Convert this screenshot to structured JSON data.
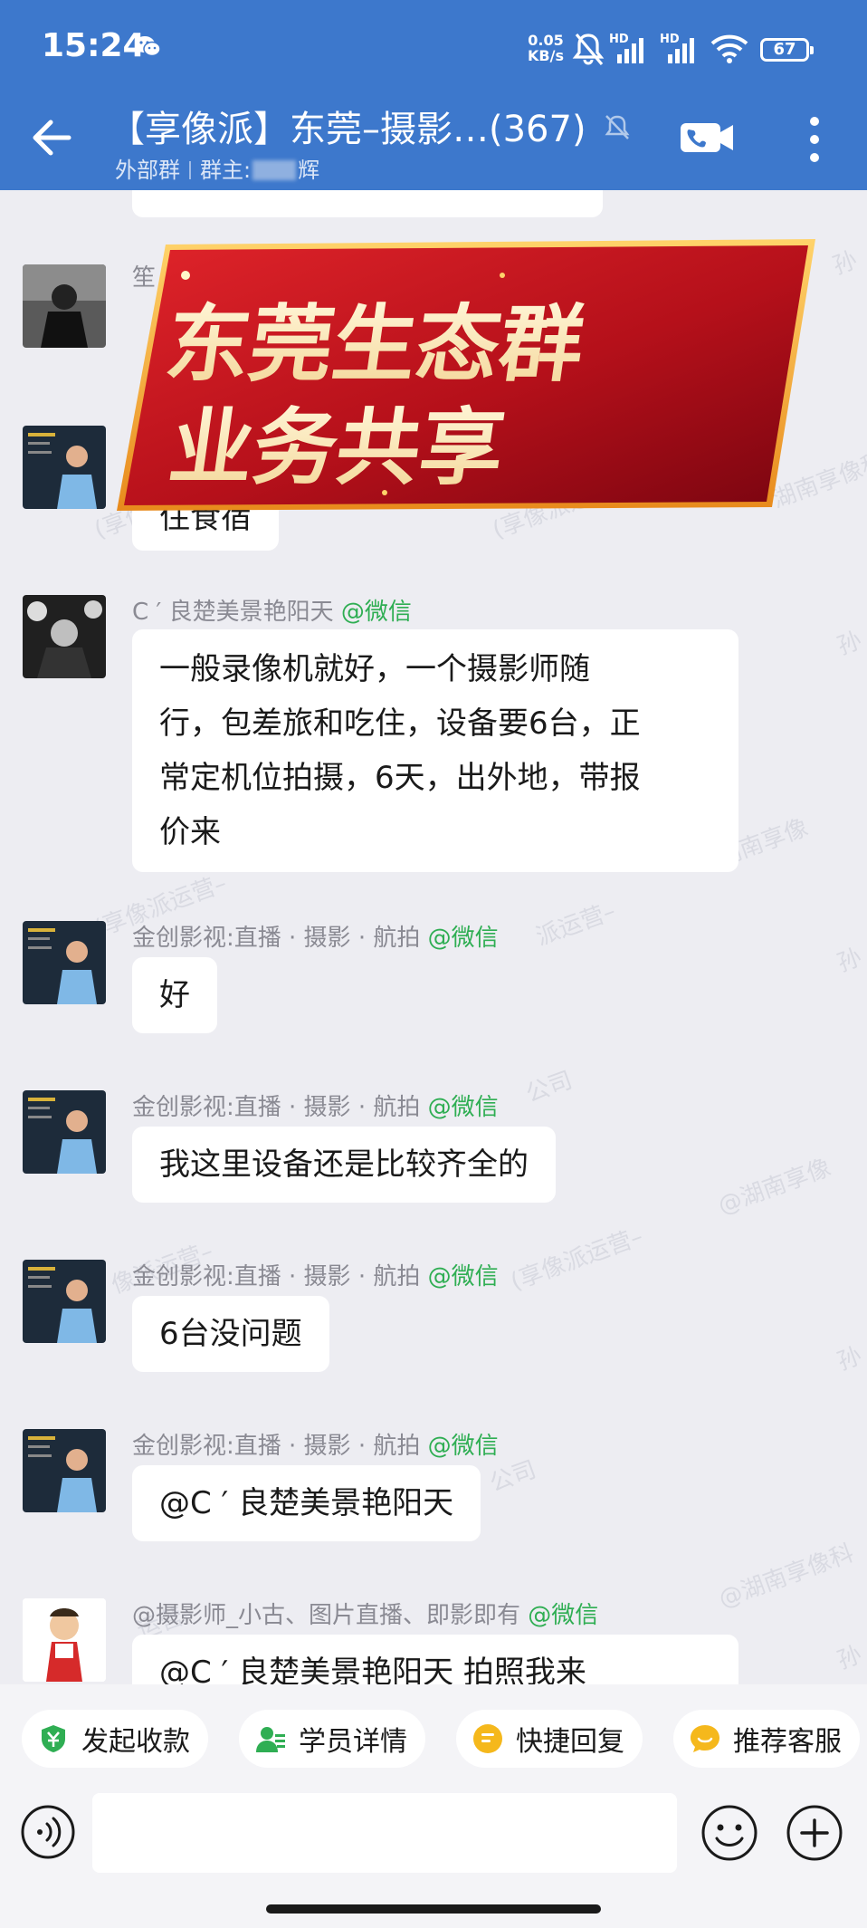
{
  "status_bar": {
    "time": "15:24",
    "net_speed_value": "0.05",
    "net_speed_unit": "KB/s",
    "signal_1_label": "HD",
    "signal_2_label": "HD",
    "battery": "67"
  },
  "header": {
    "title": "【享像派】东莞–摄影…(367)",
    "group_type": "外部群",
    "owner_label": "群主:",
    "owner_name_suffix": "辉"
  },
  "banner": {
    "line1": "东莞生态群",
    "line2": "业务共享"
  },
  "messages": [
    {
      "sender": "笙",
      "text": ""
    },
    {
      "sender": "",
      "text": "住食宿"
    },
    {
      "sender": "C ′  良楚美景艳阳天",
      "sender_tag": "@微信",
      "text_lines": [
        "一般录像机就好，一个摄影师随",
        "行，包差旅和吃住，设备要6台，正",
        "常定机位拍摄，6天，出外地，带报",
        "价来"
      ]
    },
    {
      "sender": "金创影视:直播 · 摄影 · 航拍",
      "sender_tag": "@微信",
      "text": "好"
    },
    {
      "sender": "金创影视:直播 · 摄影 · 航拍",
      "sender_tag": "@微信",
      "text": "我这里设备还是比较齐全的"
    },
    {
      "sender": "金创影视:直播 · 摄影 · 航拍",
      "sender_tag": "@微信",
      "text": "6台没问题"
    },
    {
      "sender": "金创影视:直播 · 摄影 · 航拍",
      "sender_tag": "@微信",
      "text": "@C ′  良楚美景艳阳天"
    },
    {
      "sender": "@摄影师_小古、图片直播、即影即有",
      "sender_tag": "@微信",
      "text": "@C ′  良楚美景艳阳天 拍照我来"
    }
  ],
  "watermarks": [
    "孙",
    "(享像派运营–",
    "(享像派运营–",
    "湖南享像科",
    "孙",
    "湖南享像",
    "(享像派运营–",
    "派运营–",
    "孙",
    "公司",
    "像派运营–",
    "@湖南享像",
    "孙",
    "(享像派运营–",
    "孙",
    "公司",
    "@湖南享像科",
    "运营–"
  ],
  "quick_actions": [
    {
      "label": "发起收款",
      "icon": "payment-shield-icon",
      "color": "#2fae53"
    },
    {
      "label": "学员详情",
      "icon": "student-card-icon",
      "color": "#2fae53"
    },
    {
      "label": "快捷回复",
      "icon": "quick-reply-icon",
      "color": "#f5b81c"
    },
    {
      "label": "推荐客服",
      "icon": "service-chat-icon",
      "color": "#f5b81c"
    }
  ],
  "colors": {
    "header": "#3d78cc",
    "chat_bg": "#ededf2",
    "mention": "#2fae53",
    "banner_red": "#c4141a"
  }
}
